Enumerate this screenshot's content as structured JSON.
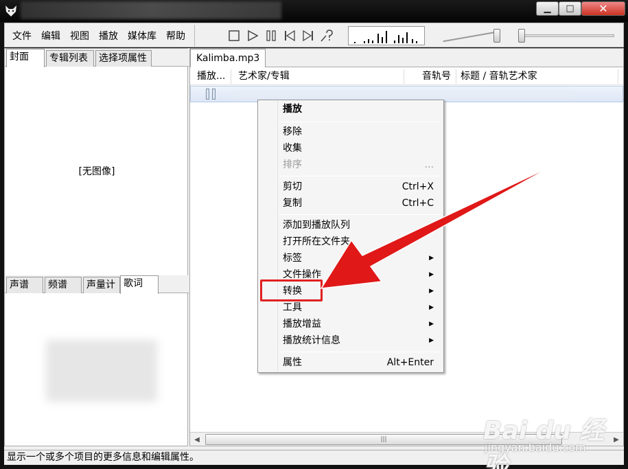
{
  "menubar": [
    "文件",
    "编辑",
    "视图",
    "播放",
    "媒体库",
    "帮助"
  ],
  "left_tabs_top": [
    "封面",
    "专辑列表",
    "选择项属性"
  ],
  "left_tabs_bottom": [
    "声谱",
    "频谱",
    "声量计",
    "歌词"
  ],
  "cover_placeholder": "[无图像]",
  "file_tab": "Kalimba.mp3",
  "columns": [
    "播放...",
    "艺术家/专辑",
    "音轨号",
    "标题 / 音轨艺术家"
  ],
  "context_menu": {
    "play": "播放",
    "remove": "移除",
    "collect": "收集",
    "sort": "排序",
    "sort_hint": "...",
    "cut": "剪切",
    "cut_shortcut": "Ctrl+X",
    "copy": "复制",
    "copy_shortcut": "Ctrl+C",
    "add_queue": "添加到播放队列",
    "open_folder": "打开所在文件夹",
    "tags": "标签",
    "file_ops": "文件操作",
    "convert": "转换",
    "tools": "工具",
    "replay_gain": "播放增益",
    "play_stats": "播放统计信息",
    "properties": "属性",
    "properties_shortcut": "Alt+Enter"
  },
  "status": "显示一个或多个项目的更多信息和编辑属性。",
  "watermark": {
    "brand": "Bai du 经验",
    "url": "jingyan.baidu.com"
  },
  "colors": {
    "highlight": "#e02020",
    "arrow": "#e01818"
  }
}
